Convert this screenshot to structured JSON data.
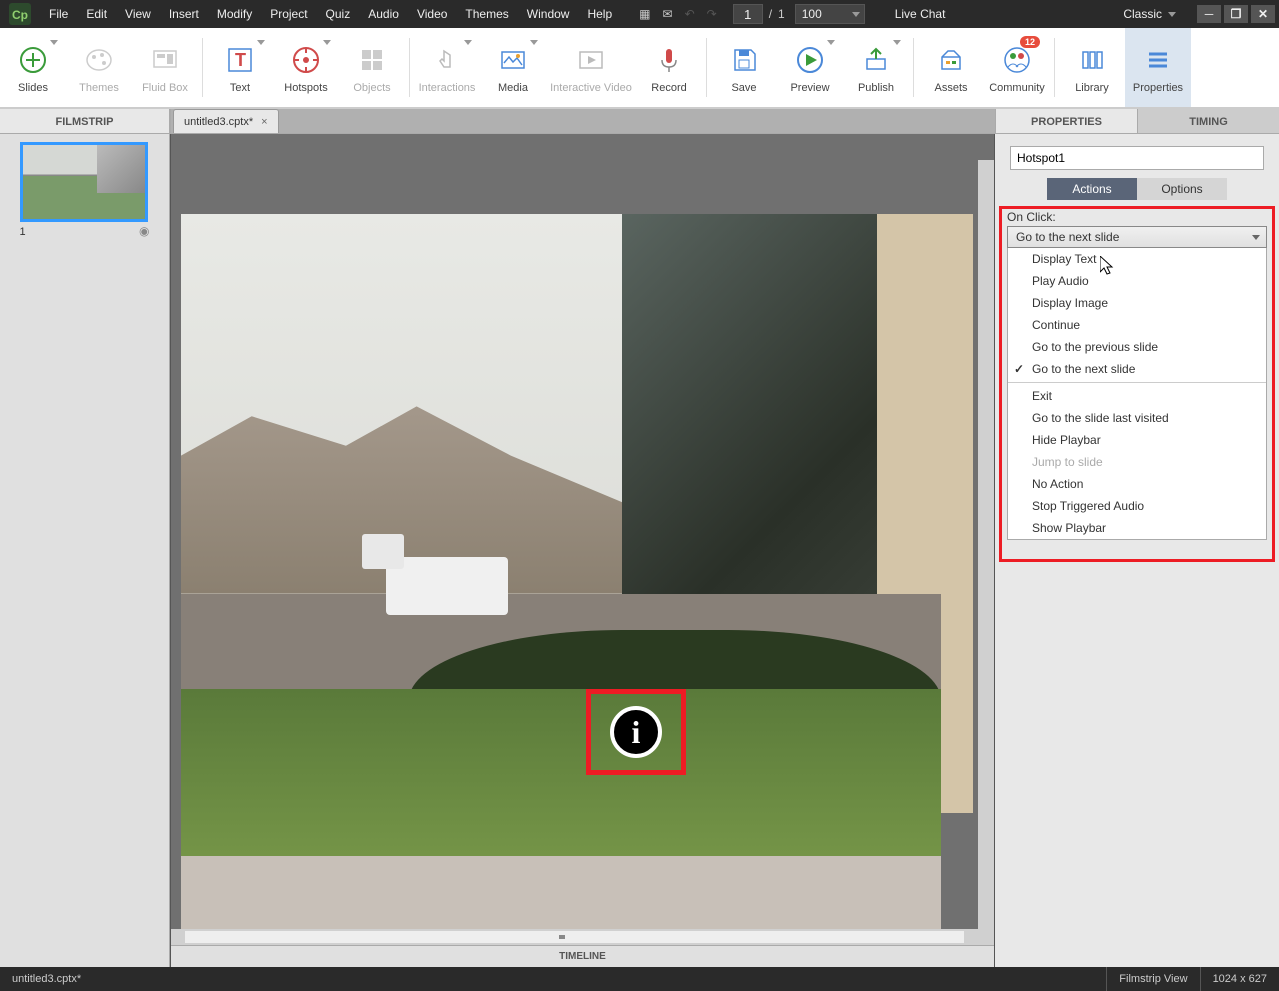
{
  "menubar": {
    "items": [
      "File",
      "Edit",
      "View",
      "Insert",
      "Modify",
      "Project",
      "Quiz",
      "Audio",
      "Video",
      "Themes",
      "Window",
      "Help"
    ],
    "pageCurrent": "1",
    "pageTotal": "1",
    "zoom": "100",
    "liveChat": "Live Chat",
    "workspace": "Classic"
  },
  "toolbar": {
    "slides": "Slides",
    "themes": "Themes",
    "fluidbox": "Fluid Box",
    "text": "Text",
    "hotspots": "Hotspots",
    "objects": "Objects",
    "interactions": "Interactions",
    "media": "Media",
    "interactiveVideo": "Interactive Video",
    "record": "Record",
    "save": "Save",
    "preview": "Preview",
    "publish": "Publish",
    "assets": "Assets",
    "community": "Community",
    "communityBadge": "12",
    "library": "Library",
    "properties": "Properties"
  },
  "panels": {
    "filmstrip": "FILMSTRIP",
    "properties": "PROPERTIES",
    "timing": "TIMING",
    "timeline": "TIMELINE"
  },
  "document": {
    "tabName": "untitled3.cptx*"
  },
  "filmstrip": {
    "thumbNumber": "1"
  },
  "properties": {
    "objectName": "Hotspot1",
    "subtabs": {
      "actions": "Actions",
      "options": "Options"
    },
    "onClickLabel": "On Click:",
    "selectedAction": "Go to the next slide",
    "actionOptions": [
      {
        "label": "Display Text",
        "checked": false,
        "disabled": false
      },
      {
        "label": "Play Audio",
        "checked": false,
        "disabled": false
      },
      {
        "label": "Display Image",
        "checked": false,
        "disabled": false
      },
      {
        "label": "Continue",
        "checked": false,
        "disabled": false
      },
      {
        "label": "Go to the previous slide",
        "checked": false,
        "disabled": false
      },
      {
        "label": "Go to the next slide",
        "checked": true,
        "disabled": false
      },
      {
        "label": "---",
        "sep": true
      },
      {
        "label": "Exit",
        "checked": false,
        "disabled": false
      },
      {
        "label": "Go to the slide last visited",
        "checked": false,
        "disabled": false
      },
      {
        "label": "Hide Playbar",
        "checked": false,
        "disabled": false
      },
      {
        "label": "Jump to slide",
        "checked": false,
        "disabled": true
      },
      {
        "label": "No Action",
        "checked": false,
        "disabled": false
      },
      {
        "label": "Stop Triggered Audio",
        "checked": false,
        "disabled": false
      },
      {
        "label": "Show Playbar",
        "checked": false,
        "disabled": false
      }
    ]
  },
  "statusbar": {
    "left": "untitled3.cptx*",
    "view": "Filmstrip View",
    "dimensions": "1024 x 627"
  }
}
